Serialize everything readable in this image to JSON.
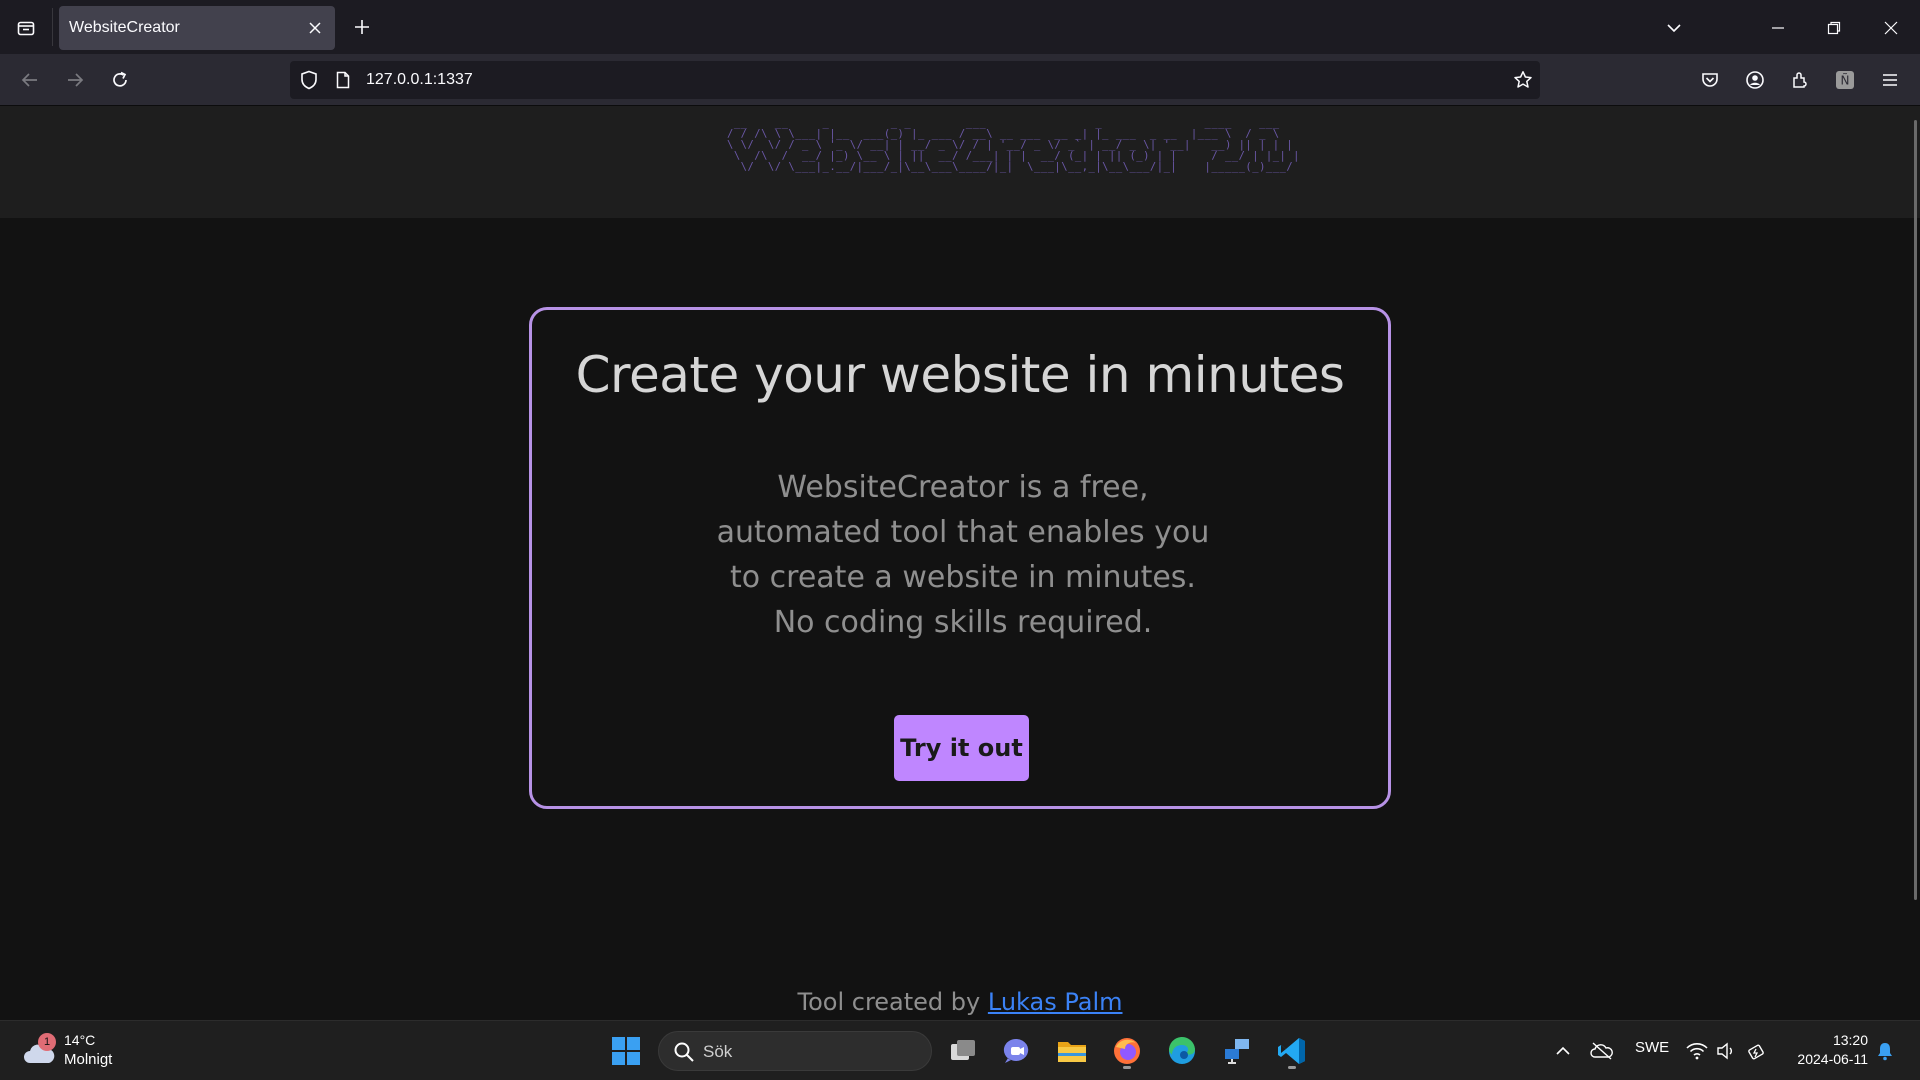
{
  "browser": {
    "tab_title": "WebsiteCreator",
    "url": "127.0.0.1:1337"
  },
  "site": {
    "logo_ascii": " __    __     _         _ _        ___                _               ____    ___  \n/ / /\\ \\ \\___| |__  ___(_) |_ ___ / __\\ __ ___  __ _| |_ ___  _ __  |___ \\  / _ \\ \n\\ \\/  \\/ / _ \\ '_ \\/ __| | __/ _ \\/ / | '__/ _ \\/ _` | __/ _ \\| '__|   __) || | | |\n \\  /\\  /  __/ |_) \\__ \\ | ||  __/ /___| | |  __/ (_| | || (_) | |     / __/ | |_| |\n  \\/  \\/ \\___|_.__/|___/_|\\__\\___\\____/|_|  \\___|\\__,_|\\__\\___/|_|    |_____(_)___/ ",
    "headline": "Create your website in minutes",
    "description": "WebsiteCreator is a free, automated tool that enables you to create a website in minutes. No coding skills required.",
    "cta_label": "Try it out",
    "footer_prefix": "Tool created by",
    "footer_author": "Lukas Palm",
    "accent_color": "#bf86ff"
  },
  "taskbar": {
    "weather_temp": "14°C",
    "weather_condition": "Molnigt",
    "weather_badge": "1",
    "search_placeholder": "Sök",
    "language": "SWE",
    "time": "13:20",
    "date": "2024-06-11"
  }
}
